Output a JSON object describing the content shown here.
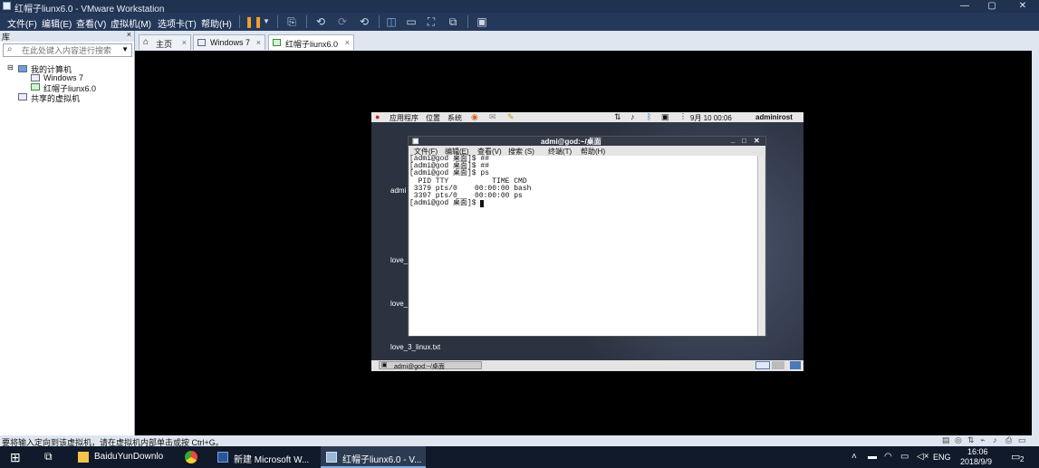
{
  "window": {
    "title": "红帽子liunx6.0 - VMware Workstation",
    "min": "—",
    "max": "▢",
    "close": "✕"
  },
  "menu": [
    "文件(F)",
    "编辑(E)",
    "查看(V)",
    "虚拟机(M)",
    "选项卡(T)",
    "帮助(H)"
  ],
  "library": {
    "header": "库",
    "close": "×",
    "search_placeholder": "在此处键入内容进行搜索",
    "tree": {
      "root": "我的计算机",
      "items": [
        "Windows 7",
        "红帽子liunx6.0"
      ],
      "shared": "共享的虚拟机"
    }
  },
  "tabs": [
    {
      "label": "主页"
    },
    {
      "label": "Windows 7"
    },
    {
      "label": "红帽子liunx6.0",
      "active": true
    }
  ],
  "guest": {
    "panel": {
      "apps": "应用程序",
      "places": "位置",
      "system": "系统",
      "datetime": "9月 10 00:06",
      "user": "adminirost"
    },
    "desktop_labels": [
      "admi",
      "love_",
      "love_",
      "love_3_linux.txt"
    ],
    "terminal": {
      "title": "admi@god:~/桌面",
      "menu": [
        "文件(F)",
        "编辑(E)",
        "查看(V)",
        "搜索 (S)",
        "终端(T)",
        "帮助(H)"
      ],
      "lines": [
        "[admi@god 桌面]$ ##",
        "[admi@god 桌面]$ ##",
        "[admi@god 桌面]$ ps",
        "  PID TTY          TIME CMD",
        " 3379 pts/0    00:00:00 bash",
        " 3397 pts/0    00:00:00 ps",
        "[admi@god 桌面]$ "
      ]
    },
    "taskbar_item": "admi@god:~/桌面"
  },
  "status": "要将输入定向到该虚拟机，请在虚拟机内部单击或按 Ctrl+G。",
  "taskbar": {
    "items": [
      "BaiduYunDownlo",
      "新建 Microsoft W...",
      "红帽子liunx6.0 - V..."
    ],
    "lang": "ENG",
    "time": "16:06",
    "date": "2018/9/9",
    "notif_count": "2"
  },
  "colors": {
    "title_bar": "#1f3350",
    "menu_bar": "#24385a",
    "taskbar": "#101a2a",
    "vm_bg": "#000000"
  }
}
